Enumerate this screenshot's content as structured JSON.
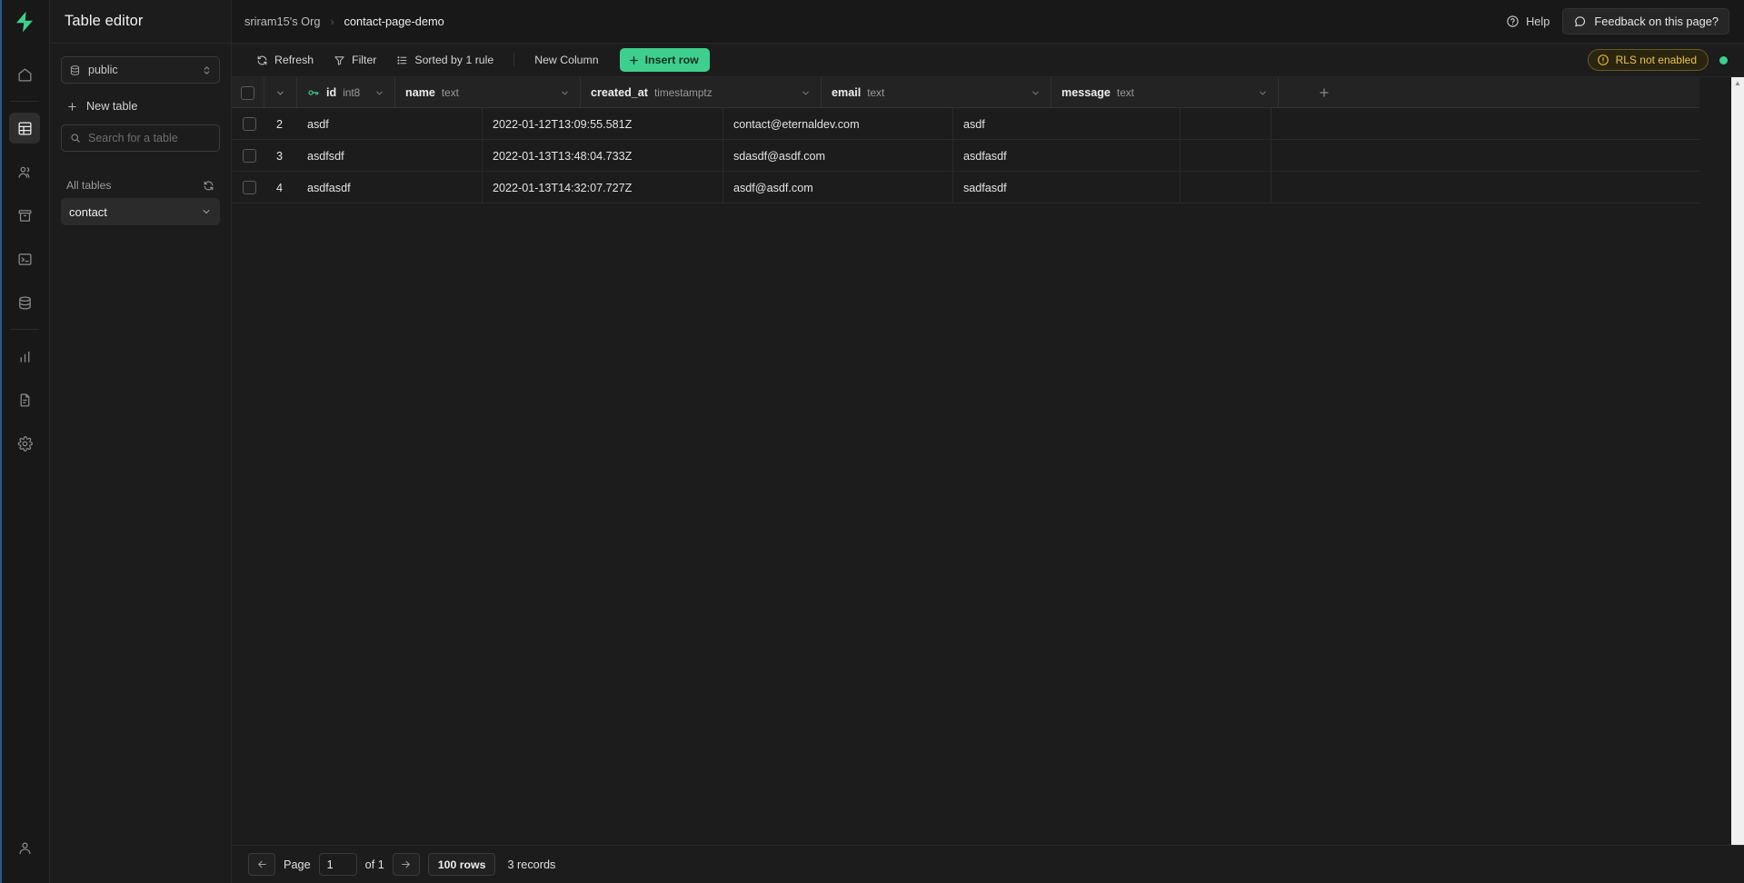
{
  "app": {
    "logo": "supabase-logo",
    "accent_color": "#3ecf8e",
    "background": "#1c1c1c"
  },
  "rail": {
    "items": [
      {
        "name": "home",
        "icon": "home-icon",
        "active": false
      },
      {
        "name": "table-editor",
        "icon": "table-icon",
        "active": true
      },
      {
        "name": "authentication",
        "icon": "users-icon",
        "active": false
      },
      {
        "name": "storage",
        "icon": "archive-icon",
        "active": false
      },
      {
        "name": "sql-editor",
        "icon": "terminal-icon",
        "active": false
      },
      {
        "name": "database",
        "icon": "database-icon",
        "active": false
      },
      {
        "name": "reports",
        "icon": "bar-chart-icon",
        "active": false
      },
      {
        "name": "logs",
        "icon": "document-icon",
        "active": false
      },
      {
        "name": "settings",
        "icon": "gear-icon",
        "active": false
      }
    ],
    "account_icon": "user-icon"
  },
  "panel": {
    "title": "Table editor",
    "schema": {
      "icon": "database-icon",
      "value": "public",
      "chevron": "chevron-updown-icon"
    },
    "new_table_label": "New table",
    "new_table_icon": "plus-icon",
    "search": {
      "placeholder": "Search for a table",
      "value": "",
      "icon": "search-icon"
    },
    "all_tables_label": "All tables",
    "refresh_icon": "refresh-icon",
    "tables": [
      {
        "label": "contact",
        "selected": true,
        "chevron": "chevron-down-icon"
      }
    ]
  },
  "topbar": {
    "breadcrumbs": [
      {
        "label": "sriram15's Org"
      },
      {
        "label": "contact-page-demo"
      }
    ],
    "separator": "›",
    "help_label": "Help",
    "help_icon": "question-circle-icon",
    "feedback_label": "Feedback on this page?",
    "feedback_icon": "chat-bubble-icon"
  },
  "toolbar": {
    "refresh_label": "Refresh",
    "refresh_icon": "refresh-icon",
    "filter_label": "Filter",
    "filter_icon": "funnel-icon",
    "sort_label": "Sorted by 1 rule",
    "sort_icon": "list-icon",
    "new_column_label": "New Column",
    "insert_row_label": "Insert row",
    "insert_row_icon": "plus-icon",
    "rls_badge_label": "RLS not enabled",
    "rls_badge_icon": "alert-circle-icon",
    "rls_badge_color": "#e8c44c",
    "status_dot_color": "#3ecf8e"
  },
  "grid": {
    "select_all_chevron": "chevron-down-icon",
    "add_column_icon": "plus-icon",
    "columns": [
      {
        "name": "id",
        "type": "int8",
        "key_icon": "primary-key-icon",
        "chevron": "chevron-down-icon"
      },
      {
        "name": "name",
        "type": "text",
        "chevron": "chevron-down-icon"
      },
      {
        "name": "created_at",
        "type": "timestamptz",
        "chevron": "chevron-down-icon"
      },
      {
        "name": "email",
        "type": "text",
        "chevron": "chevron-down-icon"
      },
      {
        "name": "message",
        "type": "text",
        "chevron": "chevron-down-icon"
      }
    ],
    "rows": [
      {
        "id": "2",
        "name": "asdf",
        "created_at": "2022-01-12T13:09:55.581Z",
        "email": "contact@eternaldev.com",
        "message": "asdf"
      },
      {
        "id": "3",
        "name": "asdfsdf",
        "created_at": "2022-01-13T13:48:04.733Z",
        "email": "sdasdf@asdf.com",
        "message": "asdfasdf"
      },
      {
        "id": "4",
        "name": "asdfasdf",
        "created_at": "2022-01-13T14:32:07.727Z",
        "email": "asdf@asdf.com",
        "message": "sadfasdf"
      }
    ]
  },
  "footer": {
    "prev_icon": "arrow-left-icon",
    "next_icon": "arrow-right-icon",
    "page_label": "Page",
    "page_value": "1",
    "of_label": "of 1",
    "rows_per_page": "100 rows",
    "records_label": "3 records"
  }
}
